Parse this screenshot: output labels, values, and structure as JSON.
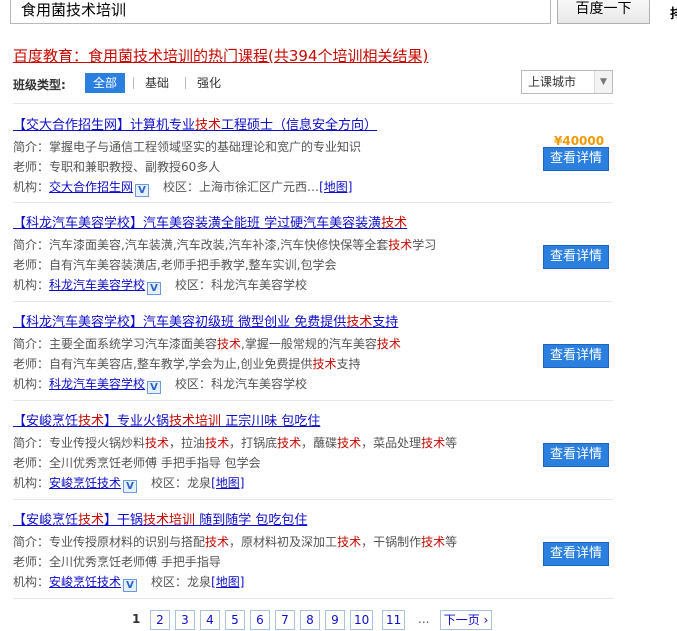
{
  "search": {
    "query": "食用菌技术培训",
    "button_label": "百度一下",
    "edge_glyph": "排"
  },
  "heading": {
    "prefix": "百度教育：",
    "keyword": "食用菌技术培训",
    "suffix": "的热门课程(共394个培训相关结果)"
  },
  "filter": {
    "label": "班级类型:",
    "tabs": [
      "全部",
      "基础",
      "强化"
    ],
    "active_tab": "全部",
    "city_select": "上课城市"
  },
  "labels": {
    "intro": "简介：",
    "teacher": "老师：",
    "org": "机构：",
    "campus": "校区：",
    "map": "[地图]",
    "detail_button": "查看详情",
    "verified": "V"
  },
  "items": [
    {
      "title": {
        "a": "【交大合作招生网】计算机专业",
        "b": "技术",
        "c": "工程硕士（信息安全方向）"
      },
      "intro": {
        "a": "掌握电子与通信工程领域坚实的基础理论和宽广的专业知识",
        "b": "",
        "c": ""
      },
      "teacher": {
        "a": "专职和兼职教授、副教授60多人",
        "b": "",
        "c": ""
      },
      "org": "交大合作招生网",
      "campus": "上海市徐汇区广元西…",
      "price": "¥40000"
    },
    {
      "title": {
        "a": "【科龙汽车美容学校】汽车美容装潢全能班 学过硬汽车美容装潢",
        "b": "技术",
        "c": ""
      },
      "intro": {
        "a": "汽车漆面美容,汽车装潢,汽车改装,汽车补漆,汽车快修快保等全套",
        "b": "技术",
        "c": "学习"
      },
      "teacher": {
        "a": "自有汽车美容装潢店,老师手把手教学,整车实训,包学会",
        "b": "",
        "c": ""
      },
      "org": "科龙汽车美容学校",
      "campus": "科龙汽车美容学校",
      "price": ""
    },
    {
      "title": {
        "a": "【科龙汽车美容学校】汽车美容初级班 微型创业 免费提供",
        "b": "技术",
        "c": "支持"
      },
      "intro": {
        "a": "主要全面系统学习汽车漆面美容",
        "b": "技术",
        "c": ",掌握一般常规的汽车美容",
        "d": "技术"
      },
      "teacher": {
        "a": "自有汽车美容店,整车教学,学会为止,创业免费提供",
        "b": "技术",
        "c": "支持"
      },
      "org": "科龙汽车美容学校",
      "campus": "科龙汽车美容学校",
      "price": ""
    },
    {
      "title": {
        "a": "【安峻烹饪",
        "b": "技术",
        "c": "】专业火锅",
        "d": "技术培训",
        "e": " 正宗川味 包吃住"
      },
      "intro": {
        "a": "专业传授火锅炒料",
        "b": "技术",
        "c": "，拉油",
        "d": "技术",
        "e": "，打锅底",
        "f": "技术",
        "g": "，蘸碟",
        "h": "技术",
        "i": "，菜品处理",
        "j": "技术",
        "k": "等"
      },
      "teacher": {
        "a": "全川优秀烹饪老师傅 手把手指导 包学会",
        "b": "",
        "c": ""
      },
      "org": "安峻烹饪技术",
      "campus": "龙泉",
      "price": ""
    },
    {
      "title": {
        "a": "【安峻烹饪",
        "b": "技术",
        "c": "】干锅",
        "d": "技术培训",
        "e": " 随到随学 包吃包住"
      },
      "intro": {
        "a": "专业传授原材料的识别与搭配",
        "b": "技术",
        "c": "，原材料初及深加工",
        "d": "技术",
        "e": "，干锅制作",
        "f": "技术",
        "g": "等"
      },
      "teacher": {
        "a": "全川优秀烹饪老师傅 手把手指导",
        "b": "",
        "c": ""
      },
      "org": "安峻烹饪技术",
      "campus": "龙泉",
      "price": ""
    }
  ],
  "pager": {
    "current": "1",
    "pages": [
      "2",
      "3",
      "4",
      "5",
      "6",
      "7",
      "8",
      "9",
      "10",
      "11"
    ],
    "ellipsis": "...",
    "next": "下一页 ›"
  }
}
